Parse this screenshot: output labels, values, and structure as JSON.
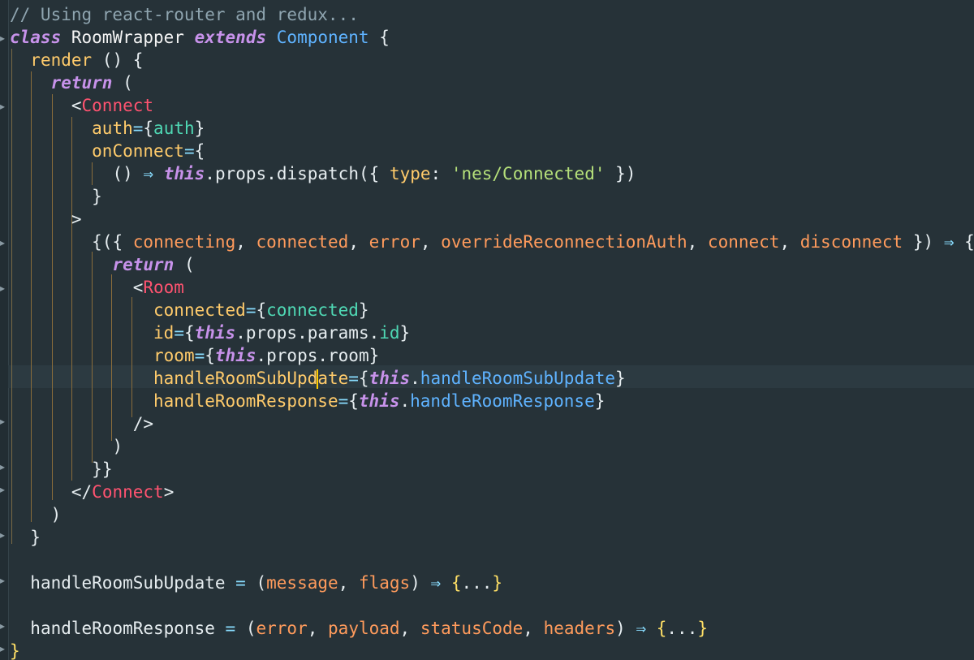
{
  "editor": {
    "lines": [
      "// Using react-router and redux...",
      "class RoomWrapper extends Component {",
      "  render () {",
      "    return (",
      "      <Connect",
      "        auth={auth}",
      "        onConnect={",
      "          () ⇒ this.props.dispatch({ type: 'nes/Connected' })",
      "        }",
      "      >",
      "        {({ connecting, connected, error, overrideReconnectionAuth, connect, disconnect }) ⇒ {",
      "          return (",
      "            <Room",
      "              connected={connected}",
      "              id={this.props.params.id}",
      "              room={this.props.room}",
      "              handleRoomSubUpdate={this.handleRoomSubUpdate}",
      "              handleRoomResponse={this.handleRoomResponse}",
      "            />",
      "          )",
      "        }}",
      "      </Connect>",
      "    )",
      "  }",
      "",
      "  handleRoomSubUpdate = (message, flags) ⇒ {...}",
      "",
      "  handleRoomResponse = (error, payload, statusCode, headers) ⇒ {...}",
      "}"
    ],
    "colors": {
      "background": "#263238",
      "keyword": "#c792ea",
      "tag": "#ff5370",
      "attribute": "#ffcb6b",
      "variable": "#4fd8b4",
      "parameter": "#ff9b5c",
      "string": "#b5e07a",
      "function": "#5fb3ff",
      "comment": "#8fa5b0",
      "cursor": "#ffcc00"
    },
    "fold_icon": "fold-arrow-icon"
  }
}
